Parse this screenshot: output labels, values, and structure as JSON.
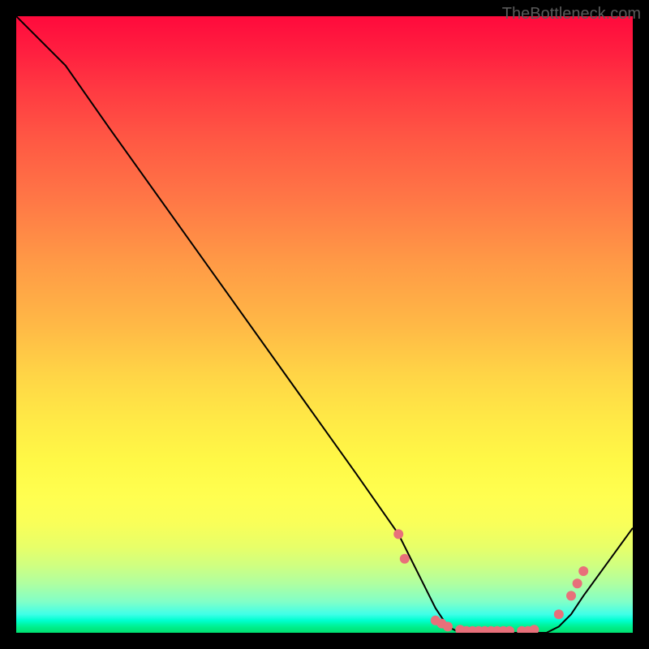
{
  "watermark": "TheBottleneck.com",
  "chart_data": {
    "type": "line",
    "title": "",
    "xlabel": "",
    "ylabel": "",
    "xlim": [
      0,
      100
    ],
    "ylim": [
      0,
      100
    ],
    "grid": false,
    "series": [
      {
        "name": "curve",
        "color": "#000000",
        "x": [
          0,
          8,
          15,
          25,
          35,
          45,
          55,
          62,
          66,
          68,
          70,
          72,
          74,
          76,
          78,
          80,
          82,
          84,
          86,
          88,
          90,
          92,
          100
        ],
        "y": [
          100,
          92,
          82,
          68,
          54,
          40,
          26,
          16,
          8,
          4,
          1,
          0,
          0,
          0,
          0,
          0,
          0,
          0,
          0,
          1,
          3,
          6,
          17
        ]
      }
    ],
    "markers": [
      {
        "x": 62,
        "y": 16,
        "color": "#e8707a"
      },
      {
        "x": 63,
        "y": 12,
        "color": "#e8707a"
      },
      {
        "x": 68,
        "y": 2,
        "color": "#e8707a"
      },
      {
        "x": 69,
        "y": 1.5,
        "color": "#e8707a"
      },
      {
        "x": 70,
        "y": 1,
        "color": "#e8707a"
      },
      {
        "x": 72,
        "y": 0.5,
        "color": "#e8707a"
      },
      {
        "x": 73,
        "y": 0.3,
        "color": "#e8707a"
      },
      {
        "x": 74,
        "y": 0.3,
        "color": "#e8707a"
      },
      {
        "x": 75,
        "y": 0.3,
        "color": "#e8707a"
      },
      {
        "x": 76,
        "y": 0.3,
        "color": "#e8707a"
      },
      {
        "x": 77,
        "y": 0.3,
        "color": "#e8707a"
      },
      {
        "x": 78,
        "y": 0.3,
        "color": "#e8707a"
      },
      {
        "x": 79,
        "y": 0.3,
        "color": "#e8707a"
      },
      {
        "x": 80,
        "y": 0.3,
        "color": "#e8707a"
      },
      {
        "x": 82,
        "y": 0.3,
        "color": "#e8707a"
      },
      {
        "x": 83,
        "y": 0.3,
        "color": "#e8707a"
      },
      {
        "x": 84,
        "y": 0.5,
        "color": "#e8707a"
      },
      {
        "x": 88,
        "y": 3,
        "color": "#e8707a"
      },
      {
        "x": 90,
        "y": 6,
        "color": "#e8707a"
      },
      {
        "x": 91,
        "y": 8,
        "color": "#e8707a"
      },
      {
        "x": 92,
        "y": 10,
        "color": "#e8707a"
      }
    ]
  }
}
